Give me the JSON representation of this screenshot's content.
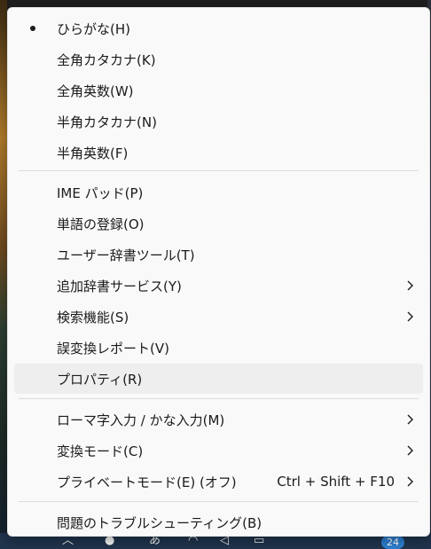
{
  "menu": {
    "items": [
      {
        "label": "ひらがな(H)",
        "selected": true
      },
      {
        "label": "全角カタカナ(K)"
      },
      {
        "label": "全角英数(W)"
      },
      {
        "label": "半角カタカナ(N)"
      },
      {
        "label": "半角英数(F)"
      },
      {
        "label": "IME パッド(P)"
      },
      {
        "label": "単語の登録(O)"
      },
      {
        "label": "ユーザー辞書ツール(T)"
      },
      {
        "label": "追加辞書サービス(Y)",
        "submenu": true
      },
      {
        "label": "検索機能(S)",
        "submenu": true
      },
      {
        "label": "誤変換レポート(V)"
      },
      {
        "label": "プロパティ(R)",
        "hovered": true
      },
      {
        "label": "ローマ字入力 / かな入力(M)",
        "submenu": true
      },
      {
        "label": "変換モード(C)",
        "submenu": true
      },
      {
        "label": "プライベートモード(E) (オフ)",
        "shortcut": "Ctrl + Shift + F10",
        "submenu": true
      },
      {
        "label": "問題のトラブルシューティング(B)"
      }
    ]
  },
  "taskbar": {
    "notification_count": "24"
  },
  "colors": {
    "menu_bg": "#f9f9f9",
    "hover_bg": "#eeeeee",
    "text": "#1b1b1b",
    "separator": "#dcdcdc",
    "badge": "#2d7fd0"
  }
}
